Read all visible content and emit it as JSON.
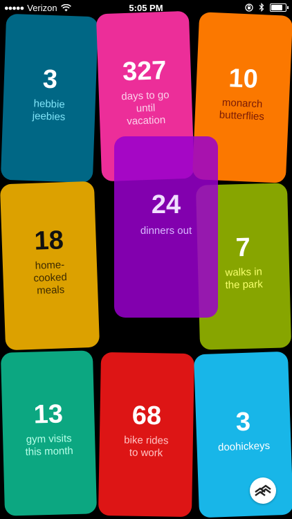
{
  "status_bar": {
    "signal": "●●●●●",
    "carrier": "Verizon",
    "time": "5:05 PM",
    "battery_level": 0.9
  },
  "tiles": [
    {
      "number": "3",
      "label": "hebbie\njeebies"
    },
    {
      "number": "327",
      "label": "days to go\nuntil\nvacation"
    },
    {
      "number": "10",
      "label": "monarch\nbutterflies"
    },
    {
      "number": "18",
      "label": "home-\ncooked\nmeals"
    },
    {
      "number": "24",
      "label": "dinners out"
    },
    {
      "number": "7",
      "label": "walks in\nthe park"
    },
    {
      "number": "13",
      "label": "gym visits\nthis month"
    },
    {
      "number": "68",
      "label": "bike rides\nto work"
    },
    {
      "number": "3",
      "label": "doohickeys"
    }
  ],
  "colors": {
    "tile_1": "#006785",
    "tile_2": "#ec2e99",
    "tile_3": "#fb7800",
    "tile_4": "#dca100",
    "tile_5": "#9900cc",
    "tile_6": "#87a500",
    "tile_7": "#0ca781",
    "tile_8": "#dd1515",
    "tile_9": "#18b6e8"
  },
  "icons": {
    "share": "share-arrows-icon",
    "wifi": "wifi-icon",
    "lock": "orientation-lock-icon",
    "bluetooth": "bluetooth-icon"
  }
}
